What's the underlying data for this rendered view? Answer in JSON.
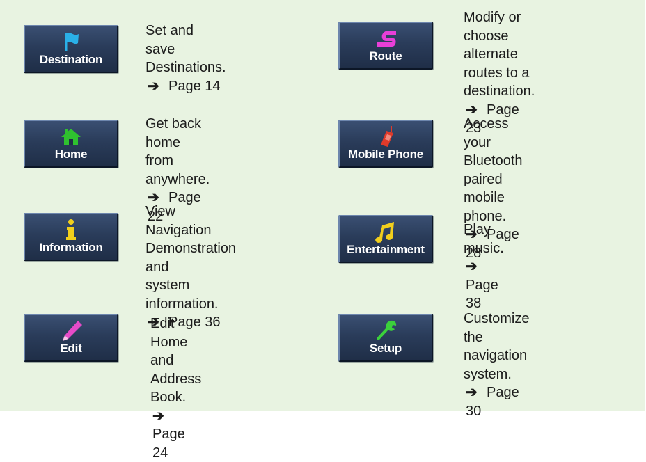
{
  "items": [
    {
      "label": "Destination",
      "icon": "flag-icon",
      "desc": "Set and save\nDestinations.",
      "page": "Page 14"
    },
    {
      "label": "Home",
      "icon": "house-icon",
      "desc": "Get back home from\nanywhere.",
      "page": "Page 22"
    },
    {
      "label": "Information",
      "icon": "info-icon",
      "desc": "View Navigation\nDemonstration and\nsystem information.",
      "page": "Page 36"
    },
    {
      "label": "Edit",
      "icon": "pencil-icon",
      "desc": "Edit Home and\nAddress Book.",
      "page": "Page 24"
    },
    {
      "label": "Route",
      "icon": "route-icon",
      "desc": "Modify or choose\nalternate routes to a\ndestination.",
      "page": "Page 23"
    },
    {
      "label": "Mobile Phone",
      "icon": "phone-icon",
      "desc": "Access your Bluetooth\npaired mobile phone.",
      "page": "Page 28"
    },
    {
      "label": "Entertainment",
      "icon": "music-note-icon",
      "desc": "Play music.",
      "page": "Page 38"
    },
    {
      "label": "Setup",
      "icon": "wrench-icon",
      "desc": "Customize the\nnavigation system.",
      "page": "Page 30"
    }
  ],
  "arrow_symbol": "➔",
  "colors": {
    "background": "#e8f3e1",
    "button": "#2a3c5a",
    "flag": "#2ab0e8",
    "house": "#2fc12f",
    "info": "#f2cf1c",
    "pencil": "#e64bc8",
    "route": "#e83fd8",
    "phone": "#e03a2a",
    "music": "#f2cf1c",
    "wrench": "#3bd13b"
  }
}
